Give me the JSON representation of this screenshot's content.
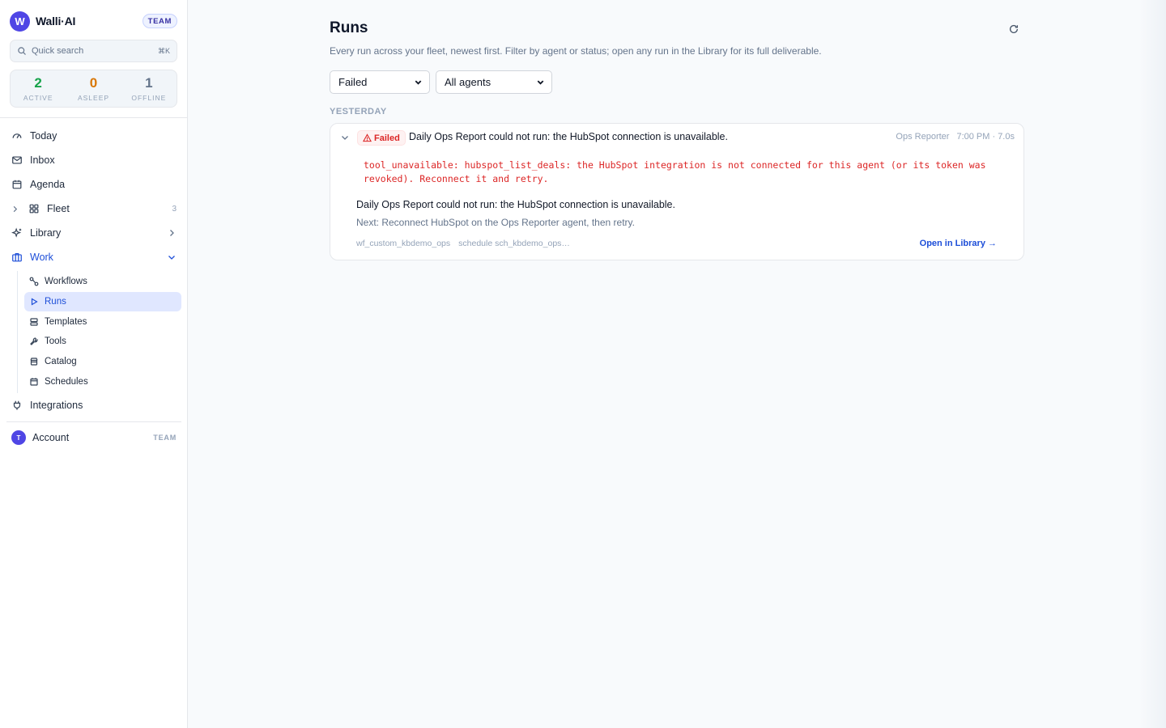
{
  "sidebar": {
    "brand": {
      "logo_letter": "W",
      "name": "Walli·AI",
      "badge": "TEAM"
    },
    "search": {
      "placeholder": "Quick search",
      "shortcut": "⌘K"
    },
    "stats": [
      {
        "value": "2",
        "label": "ACTIVE",
        "color": "#16a34a"
      },
      {
        "value": "0",
        "label": "ASLEEP",
        "color": "#d97706"
      },
      {
        "value": "1",
        "label": "OFFLINE",
        "color": "#64748b"
      }
    ],
    "nav": {
      "today": "Today",
      "inbox": "Inbox",
      "agenda": "Agenda",
      "fleet": "Fleet",
      "fleet_count": "3",
      "library": "Library",
      "work": "Work",
      "integrations": "Integrations"
    },
    "work_items": {
      "workflows": "Workflows",
      "runs": "Runs",
      "templates": "Templates",
      "tools": "Tools",
      "catalog": "Catalog",
      "schedules": "Schedules"
    },
    "account": {
      "avatar": "T",
      "label": "Account",
      "tag": "TEAM"
    }
  },
  "main": {
    "title": "Runs",
    "subtitle": "Every run across your fleet, newest first. Filter by agent or status; open any run in the Library for its full deliverable.",
    "filters": {
      "status": "Failed",
      "agent": "All agents"
    },
    "group_label": "YESTERDAY",
    "run": {
      "status": "Failed",
      "title": "Daily Ops Report could not run: the HubSpot connection is unavailable.",
      "agent": "Ops Reporter",
      "time": "7:00 PM · 7.0s",
      "error": "tool_unavailable: hubspot_list_deals: the HubSpot integration is not connected for this agent (or its token was revoked). Reconnect it and retry.",
      "summary": "Daily Ops Report could not run: the HubSpot connection is unavailable.",
      "next": "Next: Reconnect HubSpot on the Ops Reporter agent, then retry.",
      "workflow_id": "wf_custom_kbdemo_ops",
      "schedule": "schedule sch_kbdemo_ops…",
      "open_link": "Open in Library →"
    }
  },
  "colors": {
    "accent": "#1d4ed8",
    "brand": "#4f46e5",
    "danger": "#dc2626"
  }
}
